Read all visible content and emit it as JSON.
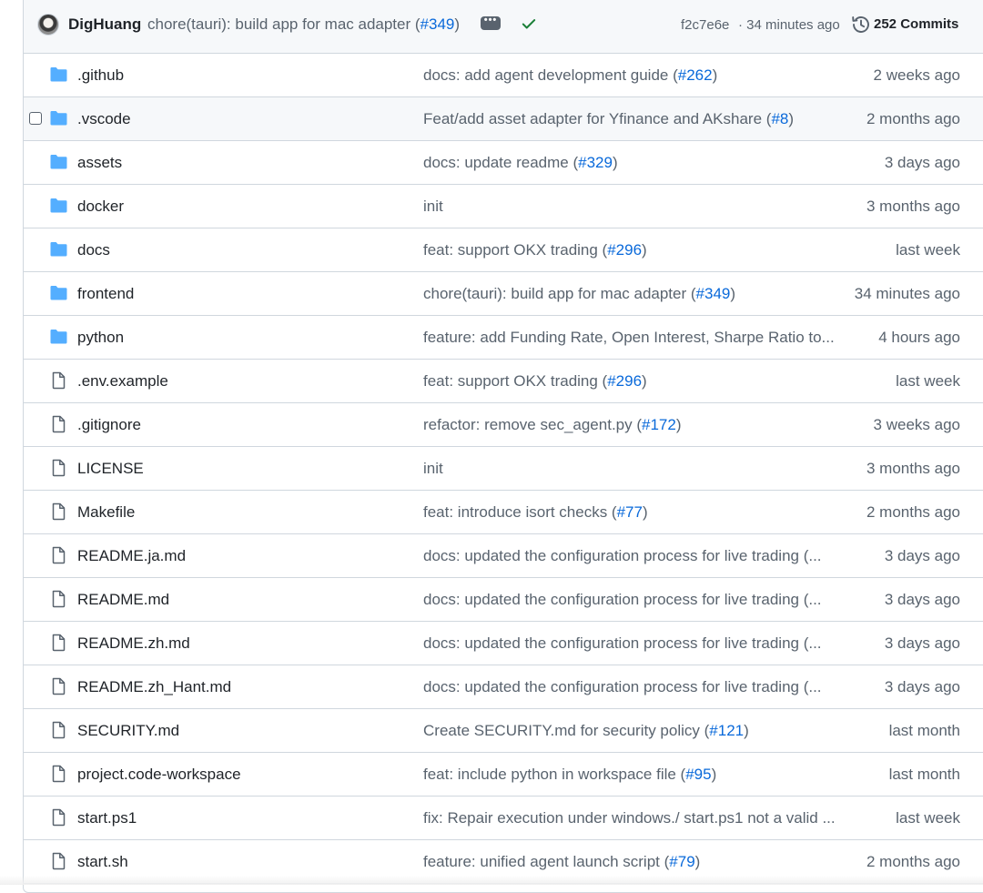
{
  "latest_commit": {
    "author": "DigHuang",
    "message_prefix": "chore(tauri): build app for mac adapter (",
    "message_pr": "#349",
    "message_suffix": ")",
    "sha": "f2c7e6e",
    "age": "· 34 minutes ago",
    "commits_label": "252 Commits",
    "status": "success"
  },
  "files": [
    {
      "type": "dir",
      "name": ".github",
      "msg_prefix": "docs: add agent development guide (",
      "pr": "#262",
      "msg_suffix": ")",
      "date": "2 weeks ago"
    },
    {
      "type": "dir",
      "name": ".vscode",
      "msg_prefix": "Feat/add asset adapter for Yfinance and AKshare (",
      "pr": "#8",
      "msg_suffix": ")",
      "date": "2 months ago",
      "hovered": true
    },
    {
      "type": "dir",
      "name": "assets",
      "msg_prefix": "docs: update readme (",
      "pr": "#329",
      "msg_suffix": ")",
      "date": "3 days ago"
    },
    {
      "type": "dir",
      "name": "docker",
      "msg_prefix": "init",
      "pr": "",
      "msg_suffix": "",
      "date": "3 months ago"
    },
    {
      "type": "dir",
      "name": "docs",
      "msg_prefix": "feat: support OKX trading (",
      "pr": "#296",
      "msg_suffix": ")",
      "date": "last week"
    },
    {
      "type": "dir",
      "name": "frontend",
      "msg_prefix": "chore(tauri): build app for mac adapter (",
      "pr": "#349",
      "msg_suffix": ")",
      "date": "34 minutes ago"
    },
    {
      "type": "dir",
      "name": "python",
      "msg_prefix": "feature: add Funding Rate, Open Interest, Sharpe Ratio to...",
      "pr": "",
      "msg_suffix": "",
      "date": "4 hours ago"
    },
    {
      "type": "file",
      "name": ".env.example",
      "msg_prefix": "feat: support OKX trading (",
      "pr": "#296",
      "msg_suffix": ")",
      "date": "last week"
    },
    {
      "type": "file",
      "name": ".gitignore",
      "msg_prefix": "refactor: remove sec_agent.py (",
      "pr": "#172",
      "msg_suffix": ")",
      "date": "3 weeks ago"
    },
    {
      "type": "file",
      "name": "LICENSE",
      "msg_prefix": "init",
      "pr": "",
      "msg_suffix": "",
      "date": "3 months ago"
    },
    {
      "type": "file",
      "name": "Makefile",
      "msg_prefix": "feat: introduce isort checks (",
      "pr": "#77",
      "msg_suffix": ")",
      "date": "2 months ago"
    },
    {
      "type": "file",
      "name": "README.ja.md",
      "msg_prefix": "docs: updated the configuration process for live trading (...",
      "pr": "",
      "msg_suffix": "",
      "date": "3 days ago"
    },
    {
      "type": "file",
      "name": "README.md",
      "msg_prefix": "docs: updated the configuration process for live trading (...",
      "pr": "",
      "msg_suffix": "",
      "date": "3 days ago"
    },
    {
      "type": "file",
      "name": "README.zh.md",
      "msg_prefix": "docs: updated the configuration process for live trading (...",
      "pr": "",
      "msg_suffix": "",
      "date": "3 days ago"
    },
    {
      "type": "file",
      "name": "README.zh_Hant.md",
      "msg_prefix": "docs: updated the configuration process for live trading (...",
      "pr": "",
      "msg_suffix": "",
      "date": "3 days ago"
    },
    {
      "type": "file",
      "name": "SECURITY.md",
      "msg_prefix": "Create SECURITY.md for security policy (",
      "pr": "#121",
      "msg_suffix": ")",
      "date": "last month"
    },
    {
      "type": "file",
      "name": "project.code-workspace",
      "msg_prefix": "feat: include python in workspace file (",
      "pr": "#95",
      "msg_suffix": ")",
      "date": "last month"
    },
    {
      "type": "file",
      "name": "start.ps1",
      "msg_prefix": "fix: Repair execution under windows./ start.ps1 not a valid ...",
      "pr": "",
      "msg_suffix": "",
      "date": "last week"
    },
    {
      "type": "file",
      "name": "start.sh",
      "msg_prefix": "feature: unified agent launch script (",
      "pr": "#79",
      "msg_suffix": ")",
      "date": "2 months ago"
    }
  ],
  "icons": {
    "dir": "folder-icon",
    "file": "file-icon"
  },
  "colors": {
    "folder": "#54aeff",
    "link": "#0969da",
    "muted": "#59636e",
    "success": "#1a7f37",
    "border": "#d0d7de"
  }
}
